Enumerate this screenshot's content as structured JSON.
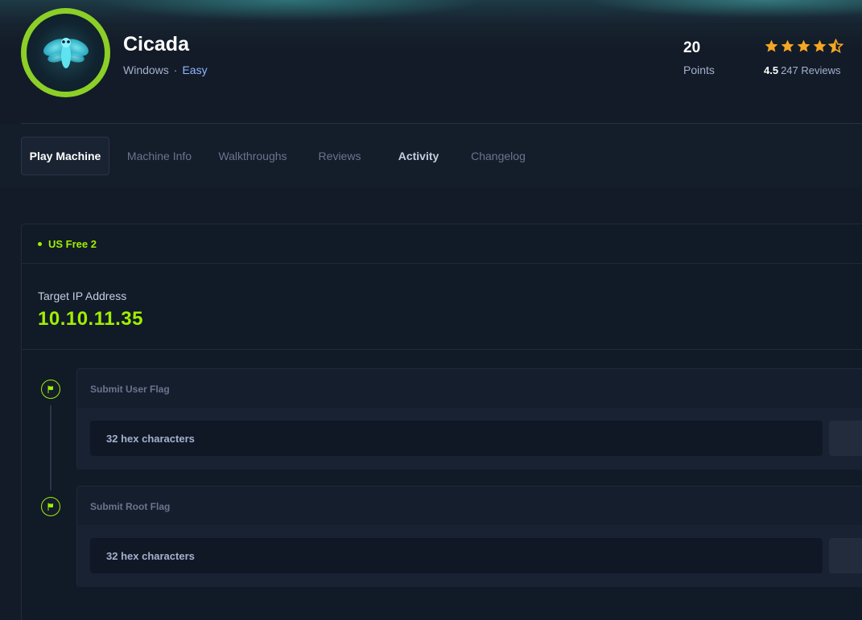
{
  "machine": {
    "name": "Cicada",
    "os": "Windows",
    "separator": "·",
    "difficulty": "Easy",
    "avatar_icon": "cicada-icon"
  },
  "stats": {
    "points_value": "20",
    "points_label": "Points",
    "rating_value": "4.5",
    "reviews_label": "247 Reviews",
    "stars": 4.5,
    "star_color": "#f5a623"
  },
  "tabs": [
    {
      "label": "Play Machine",
      "active": true
    },
    {
      "label": "Machine Info",
      "active": false
    },
    {
      "label": "Walkthroughs",
      "active": false
    },
    {
      "label": "Reviews",
      "active": false
    },
    {
      "label": "Activity",
      "active": false
    },
    {
      "label": "Changelog",
      "active": false
    }
  ],
  "play": {
    "server": "US Free 2",
    "target_label": "Target IP Address",
    "target_ip": "10.10.11.35",
    "flags": [
      {
        "title": "Submit User Flag",
        "placeholder": "32 hex characters",
        "icon": "flag-icon"
      },
      {
        "title": "Submit Root Flag",
        "placeholder": "32 hex characters",
        "icon": "flag-icon"
      }
    ]
  },
  "colors": {
    "accent_green": "#9fef00",
    "difficulty_blue": "#8fb8ff",
    "background": "#131b28"
  }
}
